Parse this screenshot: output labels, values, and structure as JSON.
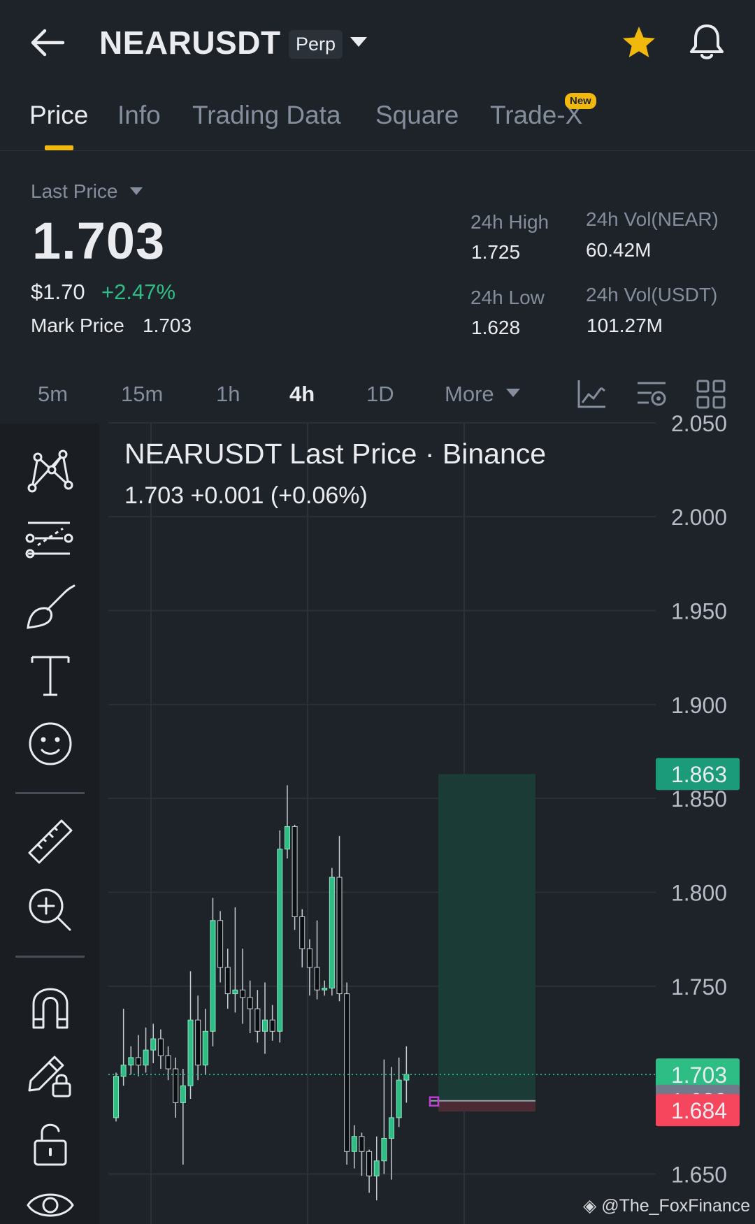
{
  "header": {
    "symbol": "NEARUSDT",
    "contract_type": "Perp",
    "back_icon": "arrow-left-icon",
    "favorite_icon": "star-icon",
    "alert_icon": "bell-icon",
    "favorite_color": "#f0b90b"
  },
  "tabs": [
    {
      "label": "Price",
      "active": true
    },
    {
      "label": "Info"
    },
    {
      "label": "Trading Data"
    },
    {
      "label": "Square"
    },
    {
      "label": "Trade-X",
      "badge": "New"
    }
  ],
  "ticker": {
    "last_price_label": "Last Price",
    "last_price": "1.703",
    "usd_price": "$1.70",
    "change_pct": "+2.47%",
    "mark_price_label": "Mark Price",
    "mark_price": "1.703",
    "high_label": "24h High",
    "high": "1.725",
    "low_label": "24h Low",
    "low": "1.628",
    "vol_near_label": "24h Vol(NEAR)",
    "vol_near": "60.42M",
    "vol_usdt_label": "24h Vol(USDT)",
    "vol_usdt": "101.27M",
    "up_color": "#2ebd85",
    "down_color": "#f6465d"
  },
  "intervals": {
    "items": [
      "5m",
      "15m",
      "1h",
      "4h",
      "1D",
      "More"
    ],
    "active": "4h",
    "icons": [
      "line-chart-icon",
      "indicator-settings-icon",
      "layout-grid-icon"
    ]
  },
  "drawing_tools": [
    "trend-lines-icon",
    "fib-lines-icon",
    "brush-icon",
    "text-icon",
    "emoji-icon",
    "ruler-icon",
    "zoom-in-icon",
    "magnet-icon",
    "lock-drawing-icon",
    "unlock-icon",
    "eye-icon"
  ],
  "chart": {
    "title": "NEARUSDT Last Price · Binance",
    "summary": "1.703  +0.001 (+0.06%)",
    "watermark": "@The_FoxFinance"
  },
  "chart_data": {
    "type": "candlestick",
    "title": "NEARUSDT Last Price · Binance",
    "y_ticks": [
      2.05,
      2.0,
      1.95,
      1.9,
      1.85,
      1.8,
      1.75,
      1.65
    ],
    "y_tick_labels": [
      "2.050",
      "2.000",
      "1.950",
      "1.900",
      "1.850",
      "1.800",
      "1.750",
      "1.650"
    ],
    "ylim": [
      1.628,
      2.055
    ],
    "grid": true,
    "last_price_line": 1.703,
    "price_tags": [
      {
        "label": "1.863",
        "value": 1.863,
        "color": "#1b9b7a"
      },
      {
        "label": "1.703",
        "value": 1.703,
        "color": "#2ebd85"
      },
      {
        "label": "1.689",
        "value": 1.689,
        "color": "#707a8a"
      },
      {
        "label": "1.684",
        "value": 1.684,
        "color": "#f6465d"
      }
    ],
    "position_box": {
      "entry": 1.689,
      "take_profit": 1.863,
      "stop_loss": 1.684
    },
    "candles": [
      [
        1.68,
        1.702,
        1.704,
        1.678
      ],
      [
        1.702,
        1.708,
        1.738,
        1.697
      ],
      [
        1.708,
        1.712,
        1.718,
        1.703
      ],
      [
        1.712,
        1.708,
        1.724,
        1.702
      ],
      [
        1.708,
        1.716,
        1.728,
        1.704
      ],
      [
        1.716,
        1.722,
        1.73,
        1.709
      ],
      [
        1.722,
        1.713,
        1.727,
        1.706
      ],
      [
        1.713,
        1.706,
        1.718,
        1.7
      ],
      [
        1.706,
        1.688,
        1.712,
        1.68
      ],
      [
        1.688,
        1.697,
        1.706,
        1.655
      ],
      [
        1.697,
        1.732,
        1.758,
        1.69
      ],
      [
        1.732,
        1.708,
        1.745,
        1.7
      ],
      [
        1.708,
        1.726,
        1.738,
        1.703
      ],
      [
        1.726,
        1.785,
        1.797,
        1.718
      ],
      [
        1.785,
        1.76,
        1.79,
        1.752
      ],
      [
        1.76,
        1.746,
        1.77,
        1.738
      ],
      [
        1.746,
        1.748,
        1.792,
        1.736
      ],
      [
        1.748,
        1.744,
        1.77,
        1.73
      ],
      [
        1.744,
        1.738,
        1.753,
        1.725
      ],
      [
        1.738,
        1.726,
        1.748,
        1.72
      ],
      [
        1.726,
        1.732,
        1.752,
        1.714
      ],
      [
        1.732,
        1.726,
        1.74,
        1.721
      ],
      [
        1.726,
        1.823,
        1.833,
        1.72
      ],
      [
        1.823,
        1.835,
        1.857,
        1.818
      ],
      [
        1.835,
        1.787,
        1.836,
        1.78
      ],
      [
        1.787,
        1.77,
        1.791,
        1.76
      ],
      [
        1.77,
        1.76,
        1.775,
        1.745
      ],
      [
        1.76,
        1.748,
        1.785,
        1.743
      ],
      [
        1.748,
        1.749,
        1.753,
        1.745
      ],
      [
        1.749,
        1.808,
        1.813,
        1.745
      ],
      [
        1.808,
        1.746,
        1.83,
        1.742
      ],
      [
        1.746,
        1.662,
        1.752,
        1.655
      ],
      [
        1.662,
        1.67,
        1.676,
        1.653
      ],
      [
        1.67,
        1.662,
        1.672,
        1.649
      ],
      [
        1.662,
        1.649,
        1.663,
        1.64
      ],
      [
        1.649,
        1.657,
        1.67,
        1.636
      ],
      [
        1.657,
        1.669,
        1.711,
        1.65
      ],
      [
        1.669,
        1.68,
        1.707,
        1.647
      ],
      [
        1.68,
        1.7,
        1.712,
        1.675
      ],
      [
        1.7,
        1.703,
        1.718,
        1.688
      ]
    ]
  }
}
